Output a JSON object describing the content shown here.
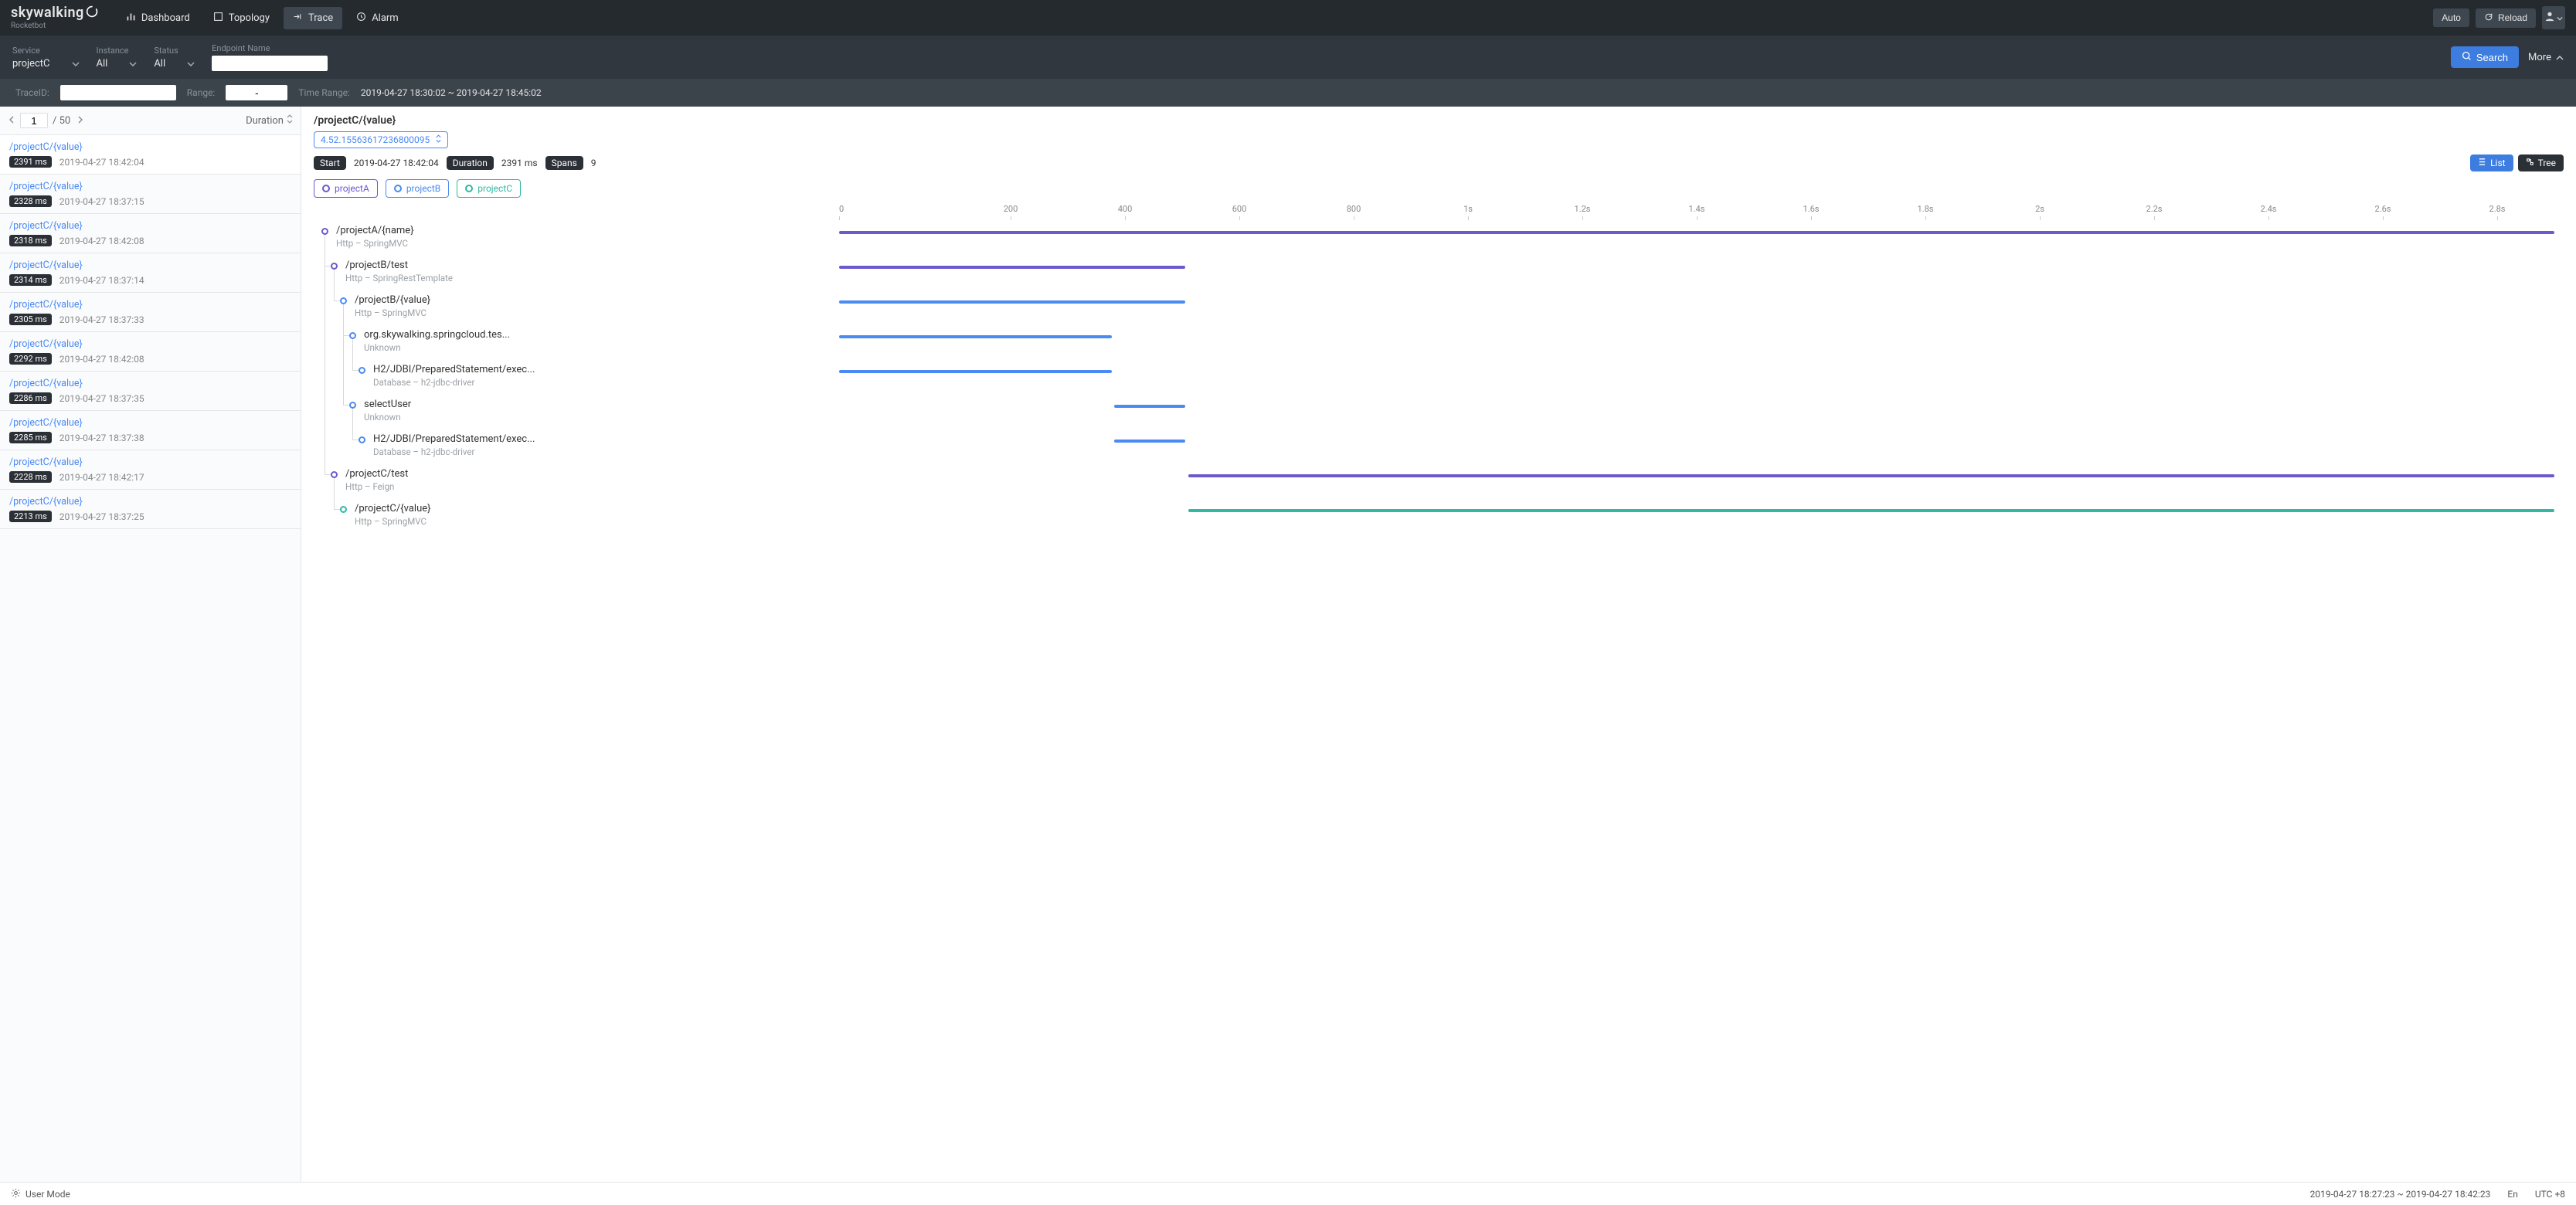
{
  "brand": {
    "name": "skywalking",
    "sub": "Rocketbot"
  },
  "nav": {
    "dashboard": "Dashboard",
    "topology": "Topology",
    "trace": "Trace",
    "alarm": "Alarm",
    "auto": "Auto",
    "reload": "Reload"
  },
  "filters": {
    "service": {
      "label": "Service",
      "value": "projectC"
    },
    "instance": {
      "label": "Instance",
      "value": "All"
    },
    "status": {
      "label": "Status",
      "value": "All"
    },
    "endpoint": {
      "label": "Endpoint Name",
      "value": ""
    },
    "search": "Search",
    "more": "More"
  },
  "subfilters": {
    "traceid_label": "TraceID:",
    "traceid_value": "",
    "range_label": "Range:",
    "range_value": "-",
    "timerange_label": "Time Range:",
    "timerange_value": "2019-04-27 18:30:02 ~ 2019-04-27 18:45:02"
  },
  "pager": {
    "page": "1",
    "total": "/ 50",
    "sort_label": "Duration"
  },
  "traces": [
    {
      "title": "/projectC/{value}",
      "dur": "2391 ms",
      "time": "2019-04-27 18:42:04"
    },
    {
      "title": "/projectC/{value}",
      "dur": "2328 ms",
      "time": "2019-04-27 18:37:15"
    },
    {
      "title": "/projectC/{value}",
      "dur": "2318 ms",
      "time": "2019-04-27 18:42:08"
    },
    {
      "title": "/projectC/{value}",
      "dur": "2314 ms",
      "time": "2019-04-27 18:37:14"
    },
    {
      "title": "/projectC/{value}",
      "dur": "2305 ms",
      "time": "2019-04-27 18:37:33"
    },
    {
      "title": "/projectC/{value}",
      "dur": "2292 ms",
      "time": "2019-04-27 18:42:08"
    },
    {
      "title": "/projectC/{value}",
      "dur": "2286 ms",
      "time": "2019-04-27 18:37:35"
    },
    {
      "title": "/projectC/{value}",
      "dur": "2285 ms",
      "time": "2019-04-27 18:37:38"
    },
    {
      "title": "/projectC/{value}",
      "dur": "2228 ms",
      "time": "2019-04-27 18:42:17"
    },
    {
      "title": "/projectC/{value}",
      "dur": "2213 ms",
      "time": "2019-04-27 18:37:25"
    }
  ],
  "detail": {
    "title": "/projectC/{value}",
    "trace_id": "4.52.15563617236800095",
    "start_label": "Start",
    "start_value": "2019-04-27 18:42:04",
    "duration_label": "Duration",
    "duration_value": "2391 ms",
    "spans_label": "Spans",
    "spans_value": "9",
    "toggle_list": "List",
    "toggle_tree": "Tree"
  },
  "legend": {
    "a": {
      "name": "projectA",
      "color": "#6a5acd"
    },
    "b": {
      "name": "projectB",
      "color": "#4a8af4"
    },
    "c": {
      "name": "projectC",
      "color": "#30b8a3"
    }
  },
  "footer": {
    "usermode": "User Mode",
    "timerange": "2019-04-27 18:27:23 ~ 2019-04-27 18:42:23",
    "lang": "En",
    "tz": "UTC +8"
  },
  "chart_data": {
    "type": "gantt",
    "total_ms": 2800,
    "ticks": [
      "0",
      "200",
      "400",
      "600",
      "800",
      "1s",
      "1.2s",
      "1.4s",
      "1.6s",
      "1.8s",
      "2s",
      "2.2s",
      "2.4s",
      "2.6s",
      "2.8s"
    ],
    "spans": [
      {
        "name": "/projectA/{name}",
        "meta": "Http – SpringMVC",
        "series": "a",
        "indent": 0,
        "start": 0,
        "end": 2800
      },
      {
        "name": "/projectB/test",
        "meta": "Http – SpringRestTemplate",
        "series": "a",
        "indent": 1,
        "start": 0,
        "end": 565
      },
      {
        "name": "/projectB/{value}",
        "meta": "Http – SpringMVC",
        "series": "b",
        "indent": 2,
        "start": 0,
        "end": 565
      },
      {
        "name": "org.skywalking.springcloud.tes...",
        "meta": "Unknown",
        "series": "b",
        "indent": 3,
        "start": 0,
        "end": 445
      },
      {
        "name": "H2/JDBI/PreparedStatement/exec...",
        "meta": "Database – h2-jdbc-driver",
        "series": "b",
        "indent": 4,
        "start": 0,
        "end": 445
      },
      {
        "name": "selectUser",
        "meta": "Unknown",
        "series": "b",
        "indent": 3,
        "start": 449,
        "end": 565
      },
      {
        "name": "H2/JDBI/PreparedStatement/exec...",
        "meta": "Database – h2-jdbc-driver",
        "series": "b",
        "indent": 4,
        "start": 449,
        "end": 565
      },
      {
        "name": "/projectC/test",
        "meta": "Http – Feign",
        "series": "a",
        "indent": 1,
        "start": 570,
        "end": 2800
      },
      {
        "name": "/projectC/{value}",
        "meta": "Http – SpringMVC",
        "series": "c",
        "indent": 2,
        "start": 570,
        "end": 2800
      }
    ]
  }
}
